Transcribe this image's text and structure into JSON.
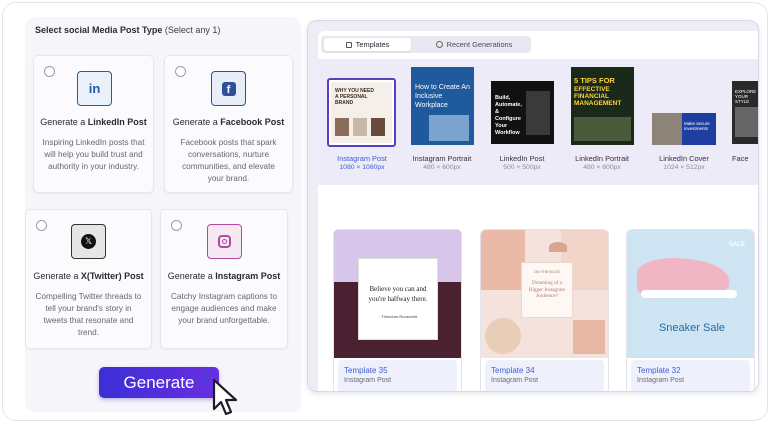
{
  "left_panel": {
    "title": "Select social Media Post Type",
    "title_hint": "(Select any 1)",
    "cards": [
      {
        "pre": "Generate a ",
        "bold": "LinkedIn Post",
        "desc": "Inspiring LinkedIn posts that will help you build trust and authority in your industry.",
        "icon": "linkedin-icon",
        "icon_color": "#1a5fa8"
      },
      {
        "pre": "Generate a ",
        "bold": "Facebook Post",
        "desc": "Facebook posts that spark conversations, nurture communities, and elevate your brand.",
        "icon": "facebook-icon",
        "icon_color": "#2f4f9c"
      },
      {
        "pre": "Generate a ",
        "bold": "X(Twitter) Post",
        "desc": "Compelling Twitter threads to tell your brand's story in tweets that resonate and trend.",
        "icon": "x-twitter-icon",
        "icon_color": "#111111"
      },
      {
        "pre": "Generate a ",
        "bold": "Instagram Post",
        "desc": "Catchy Instagram captions to engage audiences and make your brand unforgettable.",
        "icon": "instagram-icon",
        "icon_color": "#b04a9c"
      }
    ],
    "generate_label": "Generate"
  },
  "right_panel": {
    "tabs": [
      {
        "label": "Templates",
        "icon": "templates-icon",
        "active": true
      },
      {
        "label": "Recent Generations",
        "icon": "clock-icon",
        "active": false
      }
    ],
    "formats": [
      {
        "name": "Instagram Post",
        "size": "1080 × 1080px",
        "selected": true
      },
      {
        "name": "Instagram Portrait",
        "size": "480 × 600px",
        "selected": false
      },
      {
        "name": "LinkedIn Post",
        "size": "500 × 500px",
        "selected": false
      },
      {
        "name": "LinkedIn Portrait",
        "size": "480 × 600px",
        "selected": false
      },
      {
        "name": "LinkedIn Cover",
        "size": "1024 × 512px",
        "selected": false
      },
      {
        "name": "Face",
        "size": "",
        "selected": false
      }
    ],
    "thumb_texts": {
      "brand": "WHY YOU NEED A PERSONAL BRAND",
      "workplace": "How to Create An Inclusive Workplace",
      "workflow": "Build, Automate, & Configure Your Workflow",
      "finance_tips": "5 TIPS FOR",
      "finance_main": "EFFECTIVE FINANCIAL MANAGEMENT",
      "cover": "Make secure investments",
      "partial": "EXPLORE YOUR STYLE"
    },
    "templates": [
      {
        "name": "Template 35",
        "type": "Instagram Post",
        "quote": "Believe you can and you're halfway there.",
        "author": "- Theodore Roosevelt"
      },
      {
        "name": "Template 34",
        "type": "Instagram Post",
        "blog": "ON THE BLOG",
        "headline": "Dreaming of a Bigger Instagram Audience?"
      },
      {
        "name": "Template 32",
        "type": "Instagram Post",
        "headline": "Sneaker Sale",
        "badge": "SALE"
      }
    ]
  },
  "colors": {
    "accent": "#4a3fe0",
    "selected_label": "#3f5bd6",
    "template_name": "#3f5bd6"
  }
}
